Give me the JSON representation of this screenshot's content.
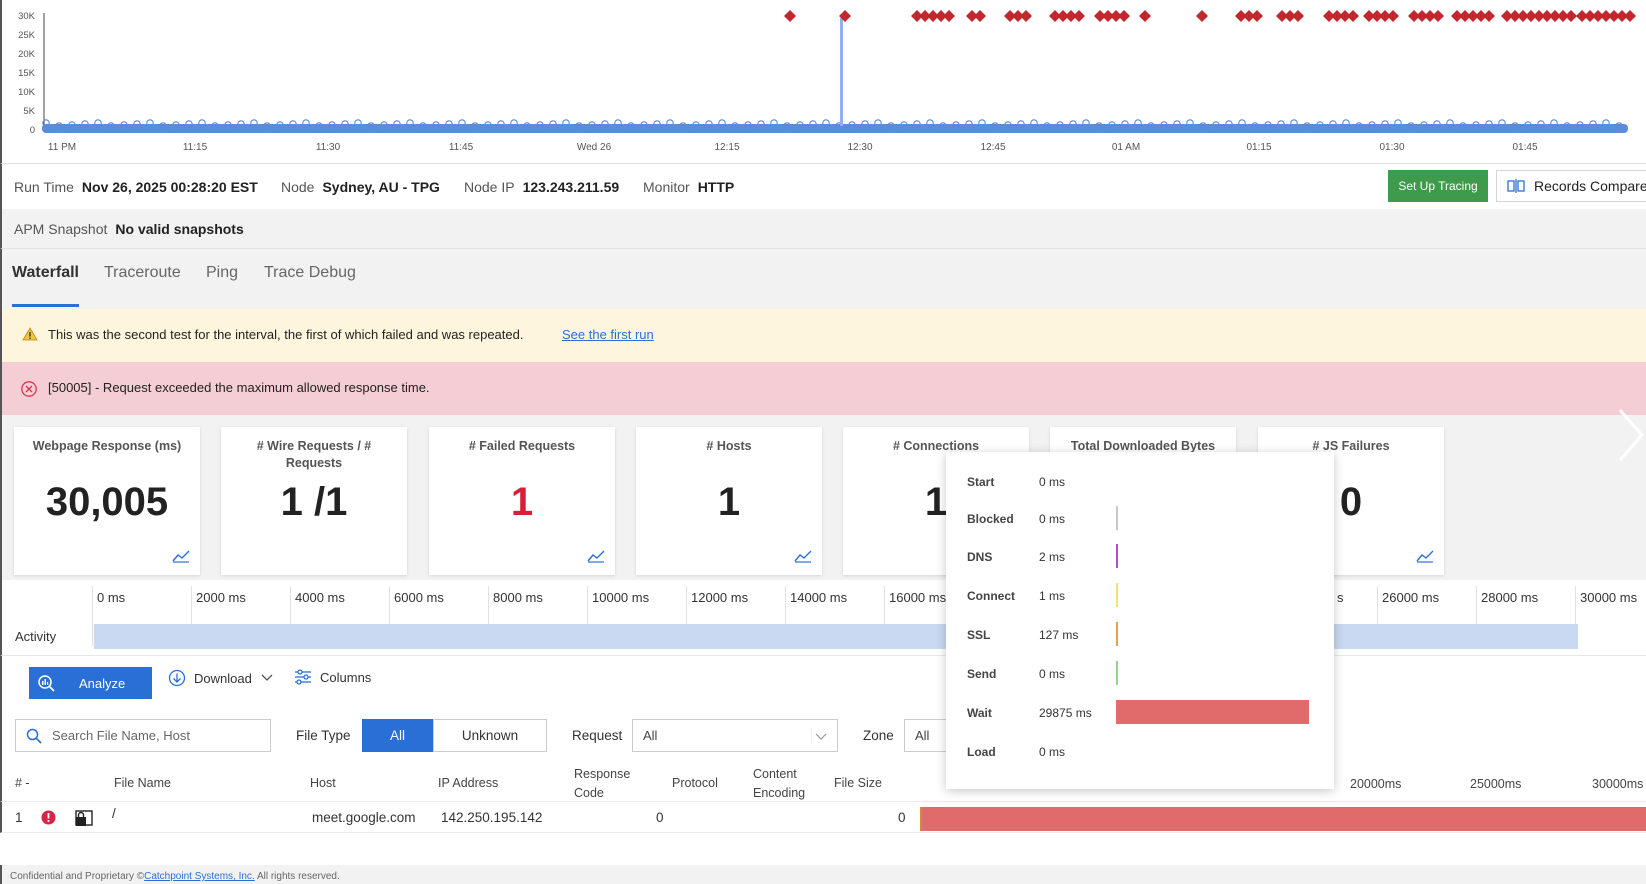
{
  "chart": {
    "y_ticks": [
      "30K",
      "25K",
      "20K",
      "15K",
      "10K",
      "5K",
      "0"
    ],
    "x_ticks": [
      "11 PM",
      "11:15",
      "11:30",
      "11:45",
      "Wed 26",
      "12:15",
      "12:30",
      "12:45",
      "01 AM",
      "01:15",
      "01:30",
      "01:45"
    ],
    "colors": {
      "line": "#5b8bd9",
      "failure": "#c0282e",
      "spike": "#8fb2ea"
    }
  },
  "run_info": {
    "run_time_label": "Run Time",
    "run_time_value": "Nov 26, 2025 00:28:20 EST",
    "node_label": "Node",
    "node_value": "Sydney, AU - TPG",
    "node_ip_label": "Node IP",
    "node_ip_value": "123.243.211.59",
    "monitor_label": "Monitor",
    "monitor_value": "HTTP",
    "setup_tracing": "Set Up Tracing",
    "records_compare": "Records Compare"
  },
  "apm": {
    "label": "APM Snapshot",
    "value": "No valid snapshots"
  },
  "tabs": [
    {
      "label": "Waterfall",
      "active": true
    },
    {
      "label": "Traceroute",
      "active": false
    },
    {
      "label": "Ping",
      "active": false
    },
    {
      "label": "Trace Debug",
      "active": false
    }
  ],
  "warning": {
    "message": "This was the second test for the interval, the first of which failed and was repeated.",
    "link": "See the first run"
  },
  "error": {
    "message": "[50005] - Request exceeded the maximum allowed response time."
  },
  "cards": [
    {
      "title": "Webpage Response (ms)",
      "value": "30,005"
    },
    {
      "title": "# Wire Requests / # Requests",
      "value": "1 /1"
    },
    {
      "title": "# Failed Requests",
      "value": "1"
    },
    {
      "title": "# Hosts",
      "value": "1"
    },
    {
      "title": "# Connections",
      "value": "1"
    },
    {
      "title": "Total Downloaded Bytes",
      "value": ""
    },
    {
      "title": "# JS Failures",
      "value": "0"
    }
  ],
  "timeline": {
    "label": "Activity",
    "ticks": [
      "0 ms",
      "2000 ms",
      "4000 ms",
      "6000 ms",
      "8000 ms",
      "10000 ms",
      "12000 ms",
      "14000 ms",
      "16000 ms",
      "s",
      "26000 ms",
      "28000 ms",
      "30000 ms"
    ]
  },
  "toolbar": {
    "analyze": "Analyze",
    "download": "Download",
    "columns": "Columns"
  },
  "filters": {
    "search_placeholder": "Search File Name, Host",
    "file_type_label": "File Type",
    "file_type_all": "All",
    "file_type_unknown": "Unknown",
    "request_label": "Request",
    "request_value": "All",
    "zone_label": "Zone",
    "zone_value": "All"
  },
  "table": {
    "headers": {
      "num": "# -",
      "file_name": "File Name",
      "host": "Host",
      "ip": "IP Address",
      "response_code_1": "Response",
      "response_code_2": "Code",
      "protocol": "Protocol",
      "content_encoding_1": "Content",
      "content_encoding_2": "Encoding",
      "file_size": "File Size",
      "t1": "20000ms",
      "t2": "25000ms",
      "t3": "30000ms"
    },
    "rows": [
      {
        "num": "1",
        "file_name": "/",
        "host": "meet.google.com",
        "ip": "142.250.195.142",
        "response_code": "0",
        "file_size": "0"
      }
    ]
  },
  "tooltip": {
    "rows": [
      {
        "label": "Start",
        "value": "0 ms",
        "color": ""
      },
      {
        "label": "Blocked",
        "value": "0 ms",
        "color": "#c8c8c8"
      },
      {
        "label": "DNS",
        "value": "2 ms",
        "color": "#b44ad8"
      },
      {
        "label": "Connect",
        "value": "1 ms",
        "color": "#f2e170"
      },
      {
        "label": "SSL",
        "value": "127 ms",
        "color": "#e9a04a"
      },
      {
        "label": "Send",
        "value": "0 ms",
        "color": "#93d68a"
      },
      {
        "label": "Wait",
        "value": "29875 ms",
        "color": "#e06b6b"
      },
      {
        "label": "Load",
        "value": "0 ms",
        "color": ""
      }
    ]
  },
  "footer": {
    "prefix": "Confidential and Proprietary ©",
    "company": "Catchpoint Systems, Inc.",
    "suffix": " All rights reserved."
  }
}
